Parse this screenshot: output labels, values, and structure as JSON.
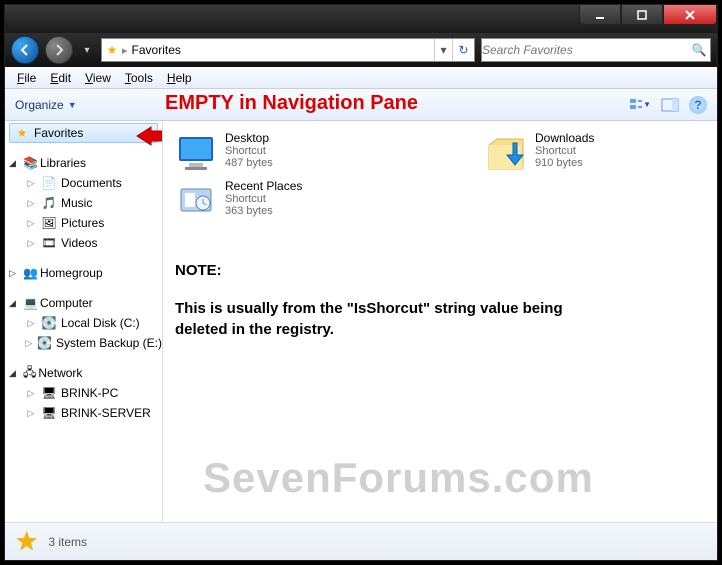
{
  "addressbar": {
    "location": "Favorites"
  },
  "search": {
    "placeholder": "Search Favorites"
  },
  "menu": {
    "file": "File",
    "edit": "Edit",
    "view": "View",
    "tools": "Tools",
    "help": "Help"
  },
  "toolbar": {
    "organize": "Organize"
  },
  "annotation": {
    "heading": "EMPTY in Navigation Pane",
    "note_label": "NOTE:",
    "note_body": "This is usually from the \"IsShorcut\" string value being deleted in the registry."
  },
  "nav": {
    "favorites": "Favorites",
    "libraries": "Libraries",
    "lib": {
      "documents": "Documents",
      "music": "Music",
      "pictures": "Pictures",
      "videos": "Videos"
    },
    "homegroup": "Homegroup",
    "computer": "Computer",
    "drives": {
      "c": "Local Disk (C:)",
      "e": "System Backup (E:)"
    },
    "network": "Network",
    "hosts": {
      "pc": "BRINK-PC",
      "server": "BRINK-SERVER"
    }
  },
  "files": {
    "desktop": {
      "name": "Desktop",
      "type": "Shortcut",
      "size": "487 bytes"
    },
    "downloads": {
      "name": "Downloads",
      "type": "Shortcut",
      "size": "910 bytes"
    },
    "recent": {
      "name": "Recent Places",
      "type": "Shortcut",
      "size": "363 bytes"
    }
  },
  "status": {
    "count": "3 items"
  },
  "watermark": "SevenForums.com"
}
